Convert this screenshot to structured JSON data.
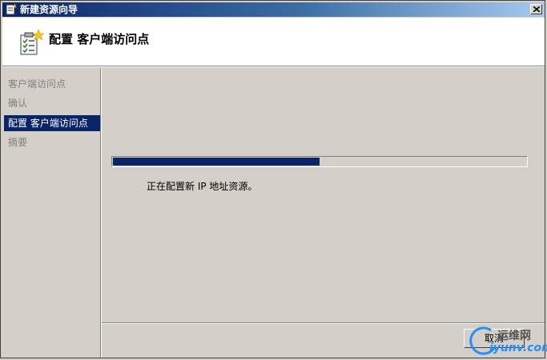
{
  "window": {
    "title": "新建资源向导"
  },
  "header": {
    "title": "配置 客户端访问点"
  },
  "sidebar": {
    "items": [
      {
        "label": "客户端访问点",
        "active": false
      },
      {
        "label": "确认",
        "active": false
      },
      {
        "label": "配置 客户端访问点",
        "active": true
      },
      {
        "label": "摘要",
        "active": false
      }
    ]
  },
  "main": {
    "progress_fraction": 0.5,
    "status_text": "正在配置新 IP 地址资源。"
  },
  "buttons": {
    "cancel_label": "取消"
  },
  "watermark": {
    "cn": "运维网",
    "en": "iyunv.com"
  },
  "colors": {
    "selection": "#0a246a",
    "progress": "#0a246a",
    "face": "#d4d0c8"
  },
  "icons": {
    "title": "wizard-icon",
    "close": "close-icon",
    "header": "wizard-clipboard-icon"
  }
}
